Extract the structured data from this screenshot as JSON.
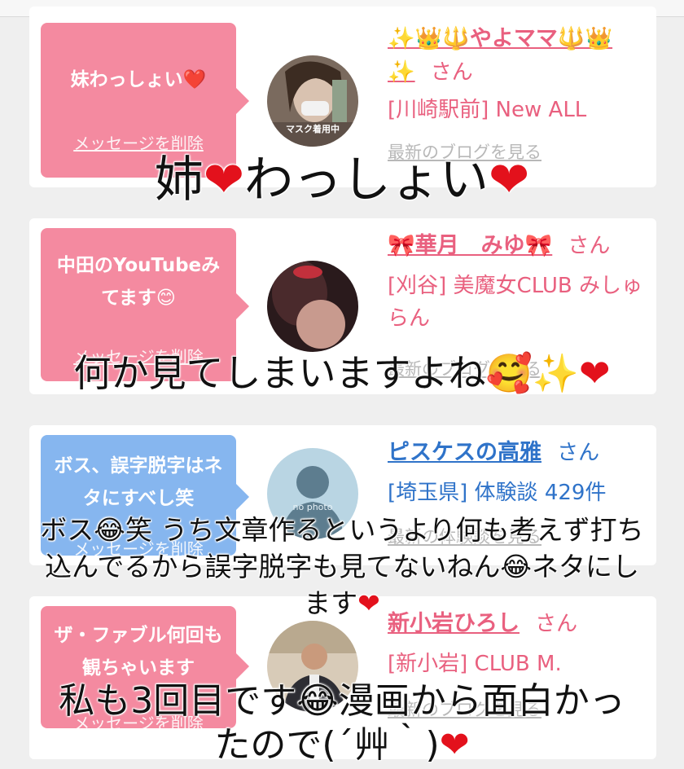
{
  "cards": [
    {
      "message": "妹わっしょい❤️",
      "delete_label": "メッセージを削除",
      "name_line1": "✨👑🔱やよママ🔱👑",
      "name_line2": "✨",
      "san": "さん",
      "detail": "[川崎駅前] New ALL",
      "link": "最新のブログを見る",
      "avatar_caption": "マスク着用中"
    },
    {
      "message": "中田のYouTubeみてます😊",
      "delete_label": "メッセージを削除",
      "name_line1": "🎀華月　みゆ🎀",
      "san": "さん",
      "detail": "[刈谷] 美魔女CLUB みしゅらん",
      "link": "最新のブログを見る"
    },
    {
      "message": "ボス、誤字脱字はネタにすべし笑",
      "delete_label": "メッセージを削除",
      "name_line1": "ピスケスの高雅",
      "san": "さん",
      "detail": "[埼玉県] 体験談 429件",
      "link": "最新の体験談を見る",
      "avatar_caption": "no photo"
    },
    {
      "message": "ザ・ファブル何回も観ちゃいます",
      "delete_label": "メッセージを削除",
      "name_line1": "新小岩ひろし",
      "san": "さん",
      "detail": "[新小岩] CLUB M.",
      "link": "最新のブログを見る"
    }
  ],
  "overlays": {
    "caption1_a": "姉",
    "caption1_b": "わっしょい",
    "caption2": "何か見てしまいますよね🥰✨",
    "caption3_line1": "ボス😂笑 うち文章作るというより何も考えず打ち",
    "caption3_line2": "込んでるから誤字脱字も見てないねん😂ネタにし",
    "caption3_line3": "ます",
    "caption4_line1": "私も3回目です😂漫画から面白かっ",
    "caption4_line2": "たので(´艸｀)",
    "heart": "❤"
  },
  "colors": {
    "pink_bubble": "#f48aa0",
    "blue_bubble": "#86b6ef",
    "pink_text": "#e9607f",
    "blue_text": "#2f73c9"
  }
}
